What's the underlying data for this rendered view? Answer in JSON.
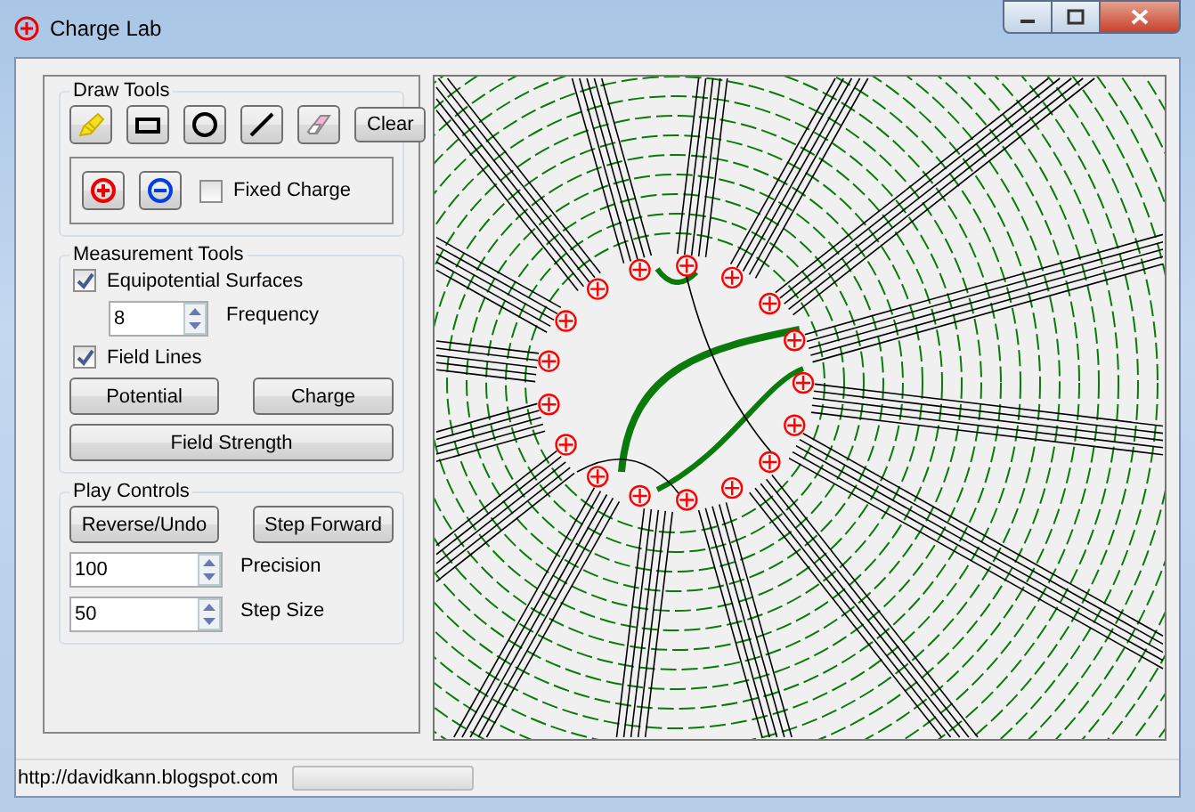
{
  "window": {
    "title": "Charge Lab"
  },
  "draw_tools": {
    "title": "Draw Tools",
    "tools": [
      {
        "kind": "pencil"
      },
      {
        "kind": "rectangle"
      },
      {
        "kind": "circle"
      },
      {
        "kind": "line"
      },
      {
        "kind": "eraser"
      }
    ],
    "clear": "Clear",
    "charges": [
      {
        "kind": "positive"
      },
      {
        "kind": "negative"
      }
    ],
    "fixed_charge": {
      "label": "Fixed Charge",
      "checked": false
    }
  },
  "measurement_tools": {
    "title": "Measurement Tools",
    "equipotential": {
      "label": "Equipotential Surfaces",
      "checked": true
    },
    "frequency": {
      "value": "8",
      "label": "Frequency"
    },
    "field_lines": {
      "label": "Field Lines",
      "checked": true
    },
    "buttons": [
      "Potential",
      "Charge"
    ],
    "wide_button": "Field Strength"
  },
  "play_controls": {
    "title": "Play Controls",
    "buttons": [
      "Reverse/Undo",
      "Step Forward"
    ],
    "precision": {
      "value": "100",
      "label": "Precision"
    },
    "step_size": {
      "value": "50",
      "label": "Step Size"
    }
  },
  "status_bar": {
    "text": "http://davidkann.blogspot.com",
    "progress": {
      "level": 0
    }
  }
}
